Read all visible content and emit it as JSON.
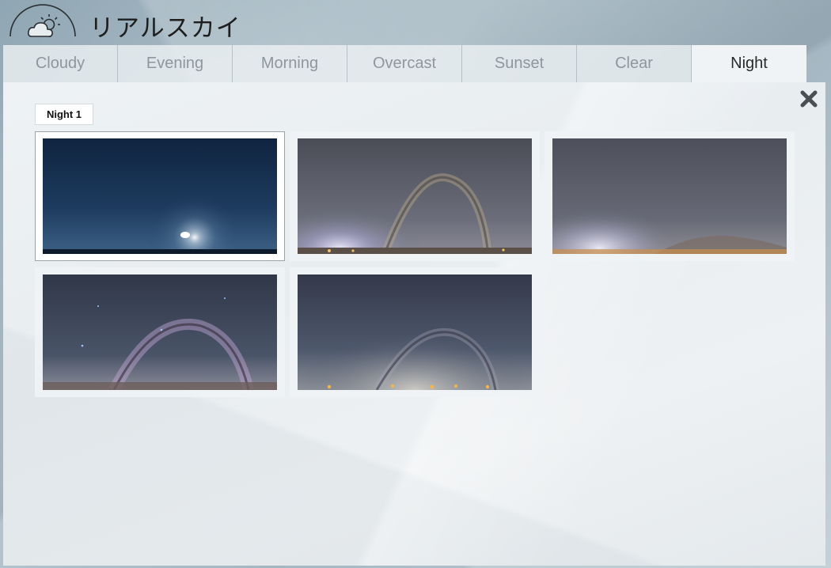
{
  "app": {
    "title": "リアルスカイ",
    "logo_icon": "cloud-sun-icon"
  },
  "tabs": [
    {
      "label": "Cloudy",
      "active": false
    },
    {
      "label": "Evening",
      "active": false
    },
    {
      "label": "Morning",
      "active": false
    },
    {
      "label": "Overcast",
      "active": false
    },
    {
      "label": "Sunset",
      "active": false
    },
    {
      "label": "Clear",
      "active": false
    },
    {
      "label": "Night",
      "active": true
    }
  ],
  "subtabs": [
    {
      "label": "Night 1",
      "active": true
    }
  ],
  "close_icon": "close-icon",
  "thumbnails": [
    {
      "name": "night-sky-blue-glow",
      "selected": true
    },
    {
      "name": "night-sky-milky-way-arc",
      "selected": false
    },
    {
      "name": "night-sky-clouds-horizon",
      "selected": false
    },
    {
      "name": "night-sky-milky-way-purple",
      "selected": false
    },
    {
      "name": "night-sky-milky-way-city-lights",
      "selected": false
    }
  ],
  "colors": {
    "active_tab_text": "#2a2a2a",
    "inactive_tab_text": "#8e979c",
    "panel_bg": "#eef2f4"
  }
}
